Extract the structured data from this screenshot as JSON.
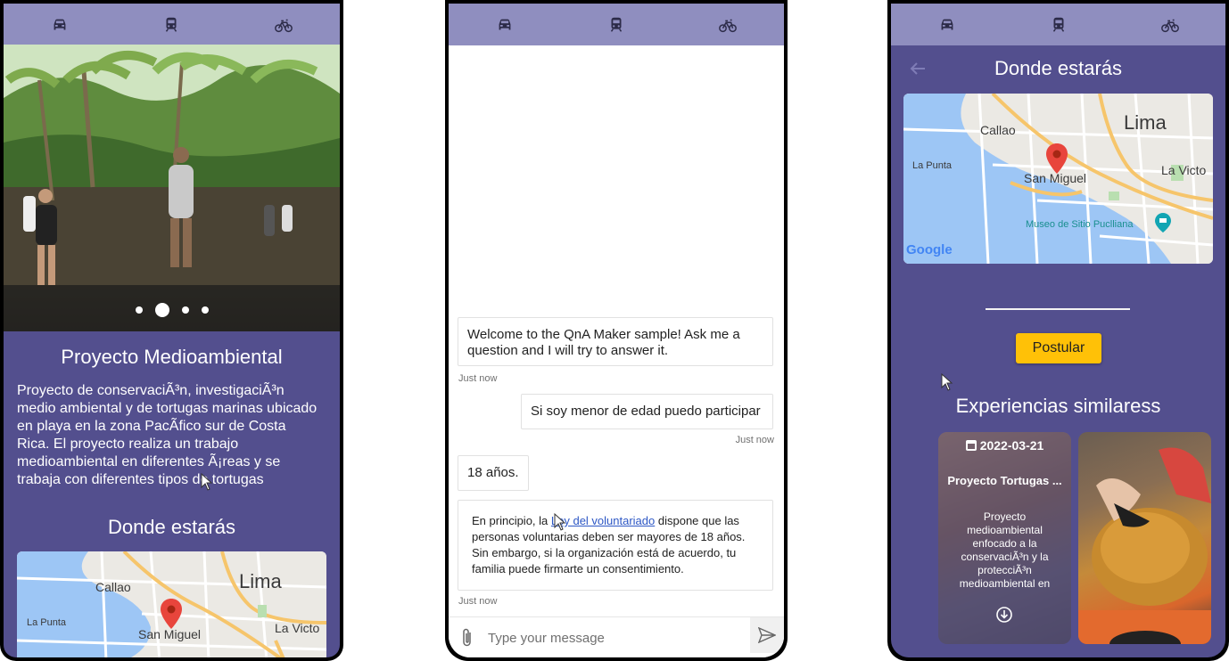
{
  "nav": {
    "icons": [
      "car-icon",
      "train-icon",
      "bicycle-icon"
    ]
  },
  "phone1": {
    "carousel": {
      "slide_count": 4,
      "active_index": 1
    },
    "project_title": "Proyecto Medioambiental",
    "project_description": "Proyecto de conservaciÃ³n, investigaciÃ³n medio ambiental y de tortugas marinas ubicado en playa en la zona PacÃ­fico sur de Costa Rica. El proyecto realiza un trabajo medioambiental en diferentes Ã¡reas y se trabaja con diferentes tipos de tortugas",
    "where_title": "Donde estarás",
    "map_labels": {
      "lima": "Lima",
      "callao": "Callao",
      "la_punta": "La Punta",
      "san_miguel": "San Miguel",
      "la_victoria": "La Victo"
    }
  },
  "phone2": {
    "messages": {
      "bot_welcome": "Welcome to the QnA Maker sample! Ask me a question and I will try to answer it.",
      "bot_welcome_time": "Just now",
      "user_question": "Si soy menor de edad puedo participar",
      "user_question_time": "Just now",
      "bot_age": "18 años.",
      "bot_answer_pre": "En principio, la ",
      "bot_answer_link": "Ley del voluntariado",
      "bot_answer_post": " dispone que las personas voluntarias deben ser mayores de 18 años. Sin embargo, si la organización está de acuerdo, tu familia puede firmarte un consentimiento.",
      "bot_answer_time": "Just now"
    },
    "composer": {
      "placeholder": "Type your message"
    }
  },
  "phone3": {
    "where_title": "Donde estarás",
    "map_labels": {
      "lima": "Lima",
      "callao": "Callao",
      "la_punta": "La Punta",
      "san_miguel": "San Miguel",
      "la_victoria": "La Victo",
      "museo": "Museo de Sitio Puclliana",
      "google": "Google"
    },
    "apply_button": "Postular",
    "similar_title": "Experiencias similaress",
    "cards": [
      {
        "date": "2022-03-21",
        "title": "Proyecto Tortugas ...",
        "description": "Proyecto medioambiental enfocado a la conservaciÃ³n y la protecciÃ³n medioambiental en"
      },
      {
        "image": "turtle-photo"
      }
    ]
  },
  "colors": {
    "nav_bar": "#8f8ebf",
    "screen_bg": "#534f8e",
    "apply_button": "#ffc107",
    "link": "#2d57c5"
  }
}
